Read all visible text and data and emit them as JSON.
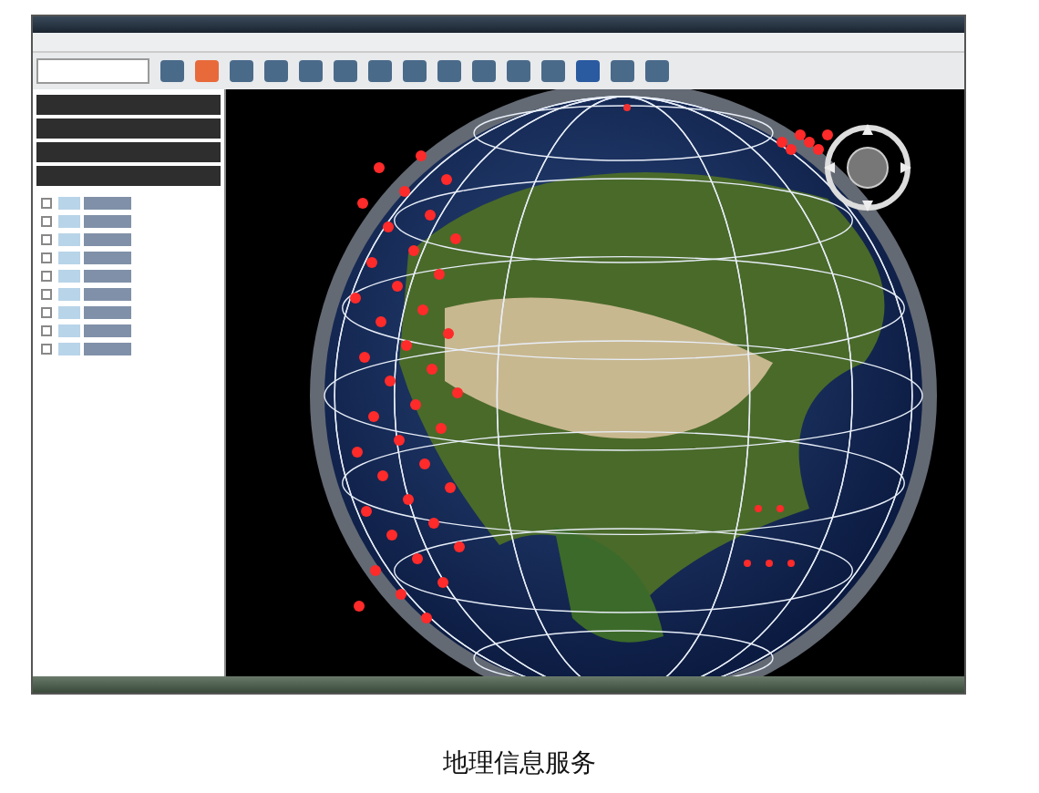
{
  "caption": "地理信息服务"
}
